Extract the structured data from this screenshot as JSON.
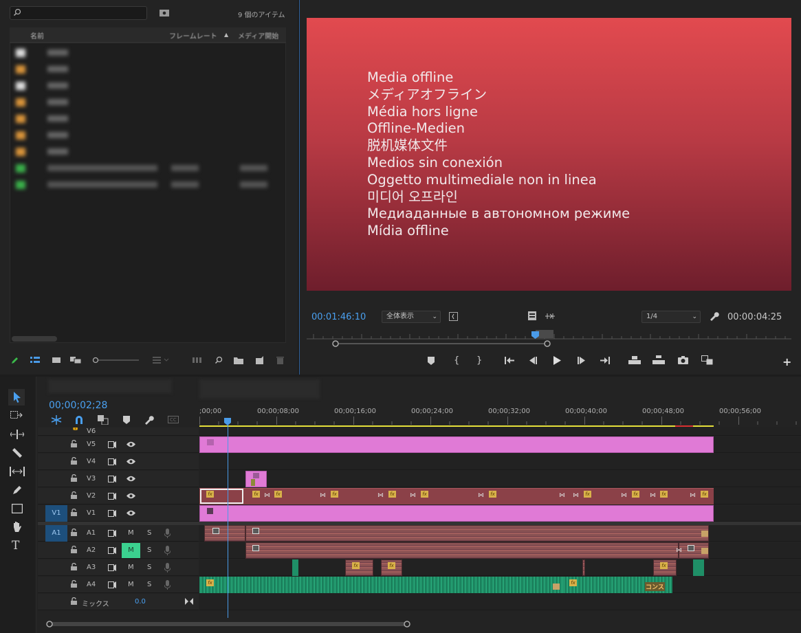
{
  "project": {
    "search_placeholder": "",
    "item_count": "9 個のアイテム",
    "columns": [
      "名前",
      "フレームレート",
      "メディア開始"
    ]
  },
  "monitor": {
    "offline_lines": [
      "Media offline",
      "メディアオフライン",
      "Média hors ligne",
      "Offline-Medien",
      "脱机媒体文件",
      "Medios sin conexión",
      "Oggetto multimediale non in linea",
      "미디어 오프라인",
      "Медиаданные в автономном режиме",
      "Mídia offline"
    ],
    "playhead_timecode": "00:01:46:10",
    "fit_label": "全体表示",
    "resolution": "1/4",
    "duration": "00:00:04:25"
  },
  "timeline": {
    "timecode": "00;00;02;28",
    "ruler_labels": [
      ";00;00",
      "00;00;08;00",
      "00;00;16;00",
      "00;00;24;00",
      "00;00;32;00",
      "00;00;40;00",
      "00;00;48;00",
      "00;00;56;00"
    ],
    "video_tracks": [
      "V6",
      "V5",
      "V4",
      "V3",
      "V2",
      "V1"
    ],
    "audio_tracks": [
      "A1",
      "A2",
      "A3",
      "A4"
    ],
    "source_v": "V1",
    "source_a": "A1",
    "mute_label": "M",
    "solo_label": "S",
    "mix_label": "ミックス",
    "mix_value": "0.0",
    "fx_label": "fx",
    "audio_clip_label": "コンス"
  },
  "colors": {
    "accent": "#4aa0f0",
    "video_clip": "#e07ad6",
    "adjust_clip": "#8b4148",
    "audio_clip": "#1f8f67",
    "offline_bg": "#c2404a"
  }
}
